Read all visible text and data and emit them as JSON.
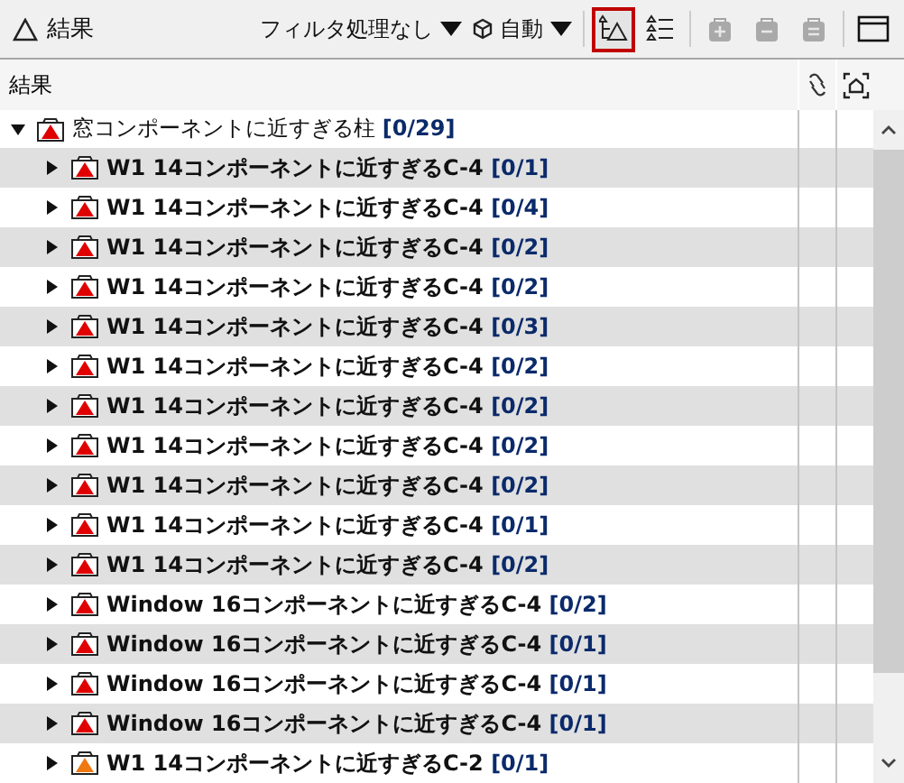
{
  "panel": {
    "title": "結果"
  },
  "toolbar": {
    "filter": "フィルタ処理なし",
    "mode": "自動",
    "tools": [
      {
        "kind": "tree",
        "selected": true,
        "disabled": false
      },
      {
        "kind": "list",
        "selected": false,
        "disabled": false
      },
      {
        "kind": "add",
        "selected": false,
        "disabled": true
      },
      {
        "kind": "remove",
        "selected": false,
        "disabled": true
      },
      {
        "kind": "edit",
        "selected": false,
        "disabled": true
      },
      {
        "kind": "window",
        "selected": false,
        "disabled": false
      }
    ]
  },
  "table": {
    "column_1": "結果"
  },
  "tree": {
    "label": "窓コンポーネントに近すぎる柱",
    "count": "[0/29]",
    "color": "#e00000",
    "expanded": true,
    "children": [
      {
        "label": "W1 14コンポーネントに近すぎるC-4",
        "count": "[0/1]",
        "color": "#e00000",
        "expanded": false
      },
      {
        "label": "W1 14コンポーネントに近すぎるC-4",
        "count": "[0/4]",
        "color": "#e00000",
        "expanded": false
      },
      {
        "label": "W1 14コンポーネントに近すぎるC-4",
        "count": "[0/2]",
        "color": "#e00000",
        "expanded": false
      },
      {
        "label": "W1 14コンポーネントに近すぎるC-4",
        "count": "[0/2]",
        "color": "#e00000",
        "expanded": false
      },
      {
        "label": "W1 14コンポーネントに近すぎるC-4",
        "count": "[0/3]",
        "color": "#e00000",
        "expanded": false
      },
      {
        "label": "W1 14コンポーネントに近すぎるC-4",
        "count": "[0/2]",
        "color": "#e00000",
        "expanded": false
      },
      {
        "label": "W1 14コンポーネントに近すぎるC-4",
        "count": "[0/2]",
        "color": "#e00000",
        "expanded": false
      },
      {
        "label": "W1 14コンポーネントに近すぎるC-4",
        "count": "[0/2]",
        "color": "#e00000",
        "expanded": false
      },
      {
        "label": "W1 14コンポーネントに近すぎるC-4",
        "count": "[0/2]",
        "color": "#e00000",
        "expanded": false
      },
      {
        "label": "W1 14コンポーネントに近すぎるC-4",
        "count": "[0/1]",
        "color": "#e00000",
        "expanded": false
      },
      {
        "label": "W1 14コンポーネントに近すぎるC-4",
        "count": "[0/2]",
        "color": "#e00000",
        "expanded": false
      },
      {
        "label": "Window 16コンポーネントに近すぎるC-4",
        "count": "[0/2]",
        "color": "#e00000",
        "expanded": false
      },
      {
        "label": "Window 16コンポーネントに近すぎるC-4",
        "count": "[0/1]",
        "color": "#e00000",
        "expanded": false
      },
      {
        "label": "Window 16コンポーネントに近すぎるC-4",
        "count": "[0/1]",
        "color": "#e00000",
        "expanded": false
      },
      {
        "label": "Window 16コンポーネントに近すぎるC-4",
        "count": "[0/1]",
        "color": "#e00000",
        "expanded": false
      },
      {
        "label": "W1 14コンポーネントに近すぎるC-2",
        "count": "[0/1]",
        "color": "#f07810",
        "expanded": false
      }
    ]
  }
}
